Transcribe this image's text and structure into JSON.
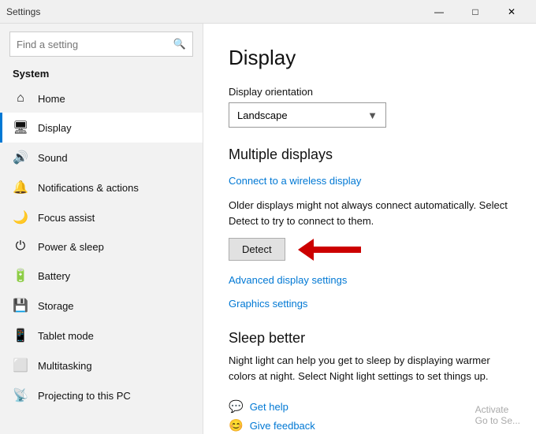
{
  "titlebar": {
    "title": "Settings",
    "minimize": "—",
    "maximize": "□",
    "close": "✕"
  },
  "sidebar": {
    "search_placeholder": "Find a setting",
    "section_title": "System",
    "items": [
      {
        "id": "home",
        "icon": "⌂",
        "label": "Home"
      },
      {
        "id": "display",
        "icon": "🖥",
        "label": "Display",
        "active": true
      },
      {
        "id": "sound",
        "icon": "🔊",
        "label": "Sound"
      },
      {
        "id": "notifications",
        "icon": "🔔",
        "label": "Notifications & actions"
      },
      {
        "id": "focus",
        "icon": "🌙",
        "label": "Focus assist"
      },
      {
        "id": "power",
        "icon": "⏻",
        "label": "Power & sleep"
      },
      {
        "id": "battery",
        "icon": "🔋",
        "label": "Battery"
      },
      {
        "id": "storage",
        "icon": "💾",
        "label": "Storage"
      },
      {
        "id": "tablet",
        "icon": "⬛",
        "label": "Tablet mode"
      },
      {
        "id": "multitasking",
        "icon": "⬜",
        "label": "Multitasking"
      },
      {
        "id": "projecting",
        "icon": "📡",
        "label": "Projecting to this PC"
      }
    ]
  },
  "content": {
    "title": "Display",
    "orientation_label": "Display orientation",
    "orientation_value": "Landscape",
    "multiple_displays_heading": "Multiple displays",
    "connect_link": "Connect to a wireless display",
    "description": "Older displays might not always connect automatically. Select Detect to try to connect to them.",
    "detect_button": "Detect",
    "advanced_link": "Advanced display settings",
    "graphics_link": "Graphics settings",
    "sleep_heading": "Sleep better",
    "sleep_description": "Night light can help you get to sleep by displaying warmer colors at night. Select Night light settings to set things up.",
    "help_link": "Get help",
    "feedback_link": "Give feedback",
    "activate_text": "Activate\nGo to Se..."
  }
}
